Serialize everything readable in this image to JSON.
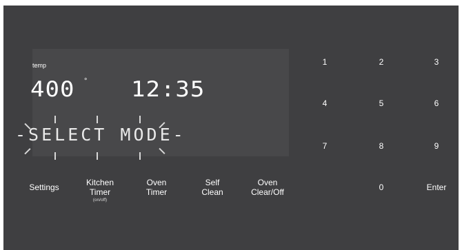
{
  "display": {
    "temp_label": "temp",
    "temperature": "400",
    "degree_symbol": "°",
    "clock": "12:35",
    "mode_text": "-SELECT MODE-"
  },
  "function_keys": [
    {
      "line1": "Settings",
      "line2": "",
      "sub": ""
    },
    {
      "line1": "Kitchen",
      "line2": "Timer",
      "sub": "(on/off)"
    },
    {
      "line1": "Oven",
      "line2": "Timer",
      "sub": ""
    },
    {
      "line1": "Self",
      "line2": "Clean",
      "sub": ""
    },
    {
      "line1": "Oven",
      "line2": "Clear/Off",
      "sub": ""
    }
  ],
  "keypad": [
    "1",
    "2",
    "3",
    "4",
    "5",
    "6",
    "7",
    "8",
    "9",
    "0",
    "Enter"
  ],
  "colors": {
    "panel": "#3f3f41",
    "display": "#48484a",
    "text": "#ffffff"
  }
}
